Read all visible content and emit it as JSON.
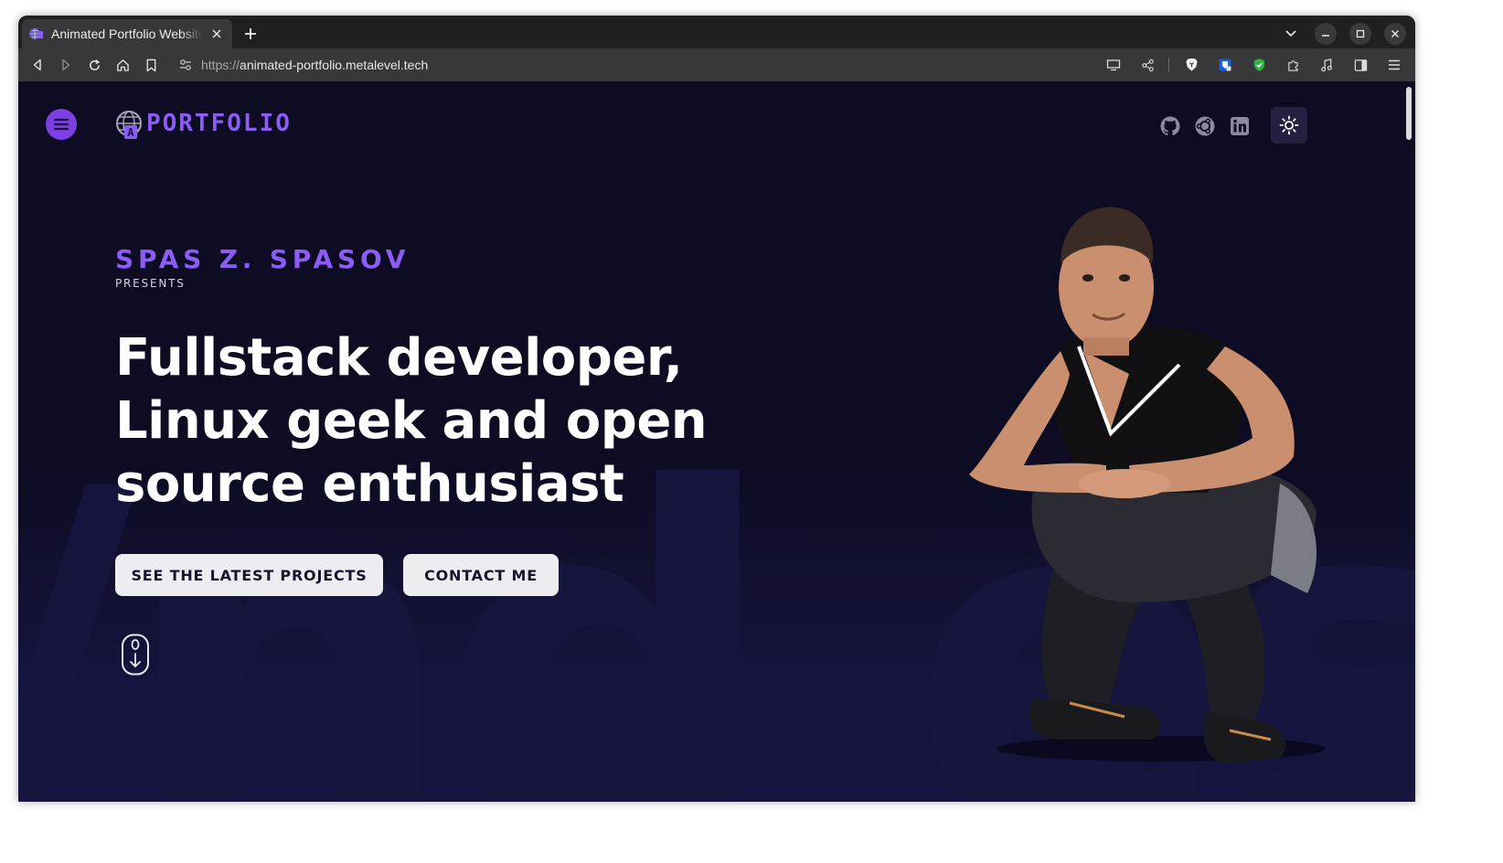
{
  "browser": {
    "tab_title": "Animated Portfolio Website",
    "url_scheme": "https://",
    "url_host": "animated-portfolio.metalevel.tech"
  },
  "site": {
    "logo_text": "PORTFOLIO",
    "author": "SPAS Z. SPASOV",
    "presents": "PRESENTS",
    "headline": "Fullstack developer, Linux geek and open source enthusiast",
    "buttons": {
      "projects": "SEE THE LATEST PROJECTS",
      "contact": "CONTACT ME"
    },
    "background_letters": "/nd es",
    "social_icons": [
      "github-icon",
      "ubuntu-icon",
      "linkedin-icon"
    ],
    "theme_toggle_icon": "sun-icon"
  },
  "colors": {
    "page_bg": "#0d0c23",
    "accent": "#8b5cf6",
    "menu_button": "#7b3fe4",
    "button_bg": "#ececf1",
    "text": "#ffffff"
  }
}
